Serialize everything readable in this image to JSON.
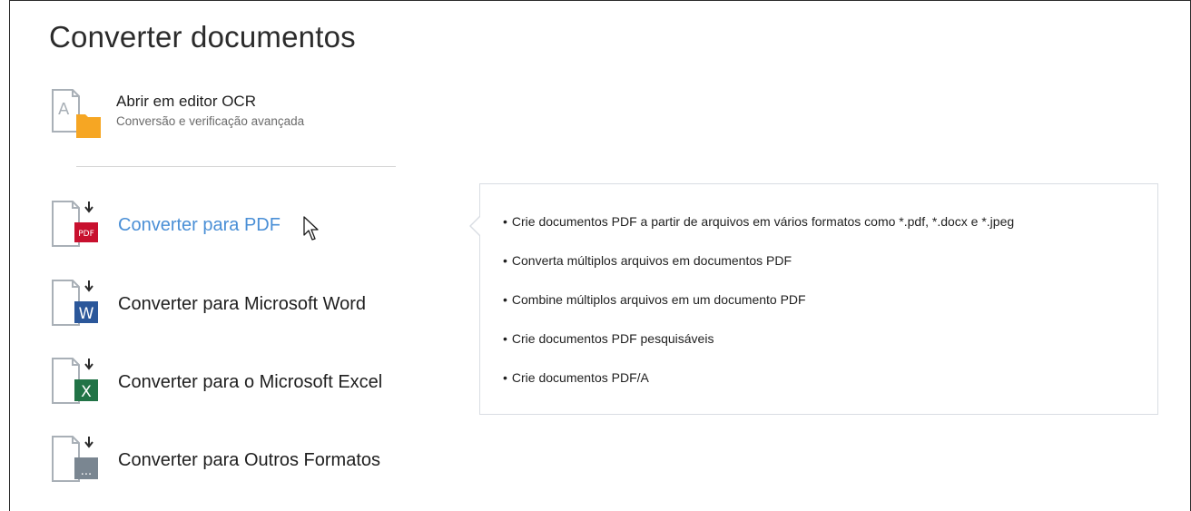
{
  "page": {
    "title": "Converter documentos"
  },
  "ocr": {
    "label": "Abrir em editor OCR",
    "sublabel": "Conversão e verificação avançada"
  },
  "items": [
    {
      "label": "Converter para PDF",
      "icon": "pdf-document-icon",
      "badge": "PDF",
      "badge_color": "#c8102e",
      "active": true
    },
    {
      "label": "Converter para Microsoft Word",
      "icon": "word-document-icon",
      "badge": "W",
      "badge_color": "#2b579a"
    },
    {
      "label": "Converter para o Microsoft Excel",
      "icon": "excel-document-icon",
      "badge": "X",
      "badge_color": "#217346"
    },
    {
      "label": "Converter para Outros Formatos",
      "icon": "other-formats-document-icon",
      "badge": "...",
      "badge_color": "#7a8691"
    }
  ],
  "tooltip": {
    "bullets": [
      "Crie documentos PDF a partir de arquivos em vários formatos como *.pdf, *.docx e *.jpeg",
      "Converta múltiplos arquivos em documentos PDF",
      "Combine múltiplos arquivos em um documento PDF",
      "Crie documentos PDF pesquisáveis",
      "Crie documentos PDF/A"
    ]
  },
  "colors": {
    "accent": "#4a8fd6",
    "ocr_folder": "#f6a623"
  }
}
